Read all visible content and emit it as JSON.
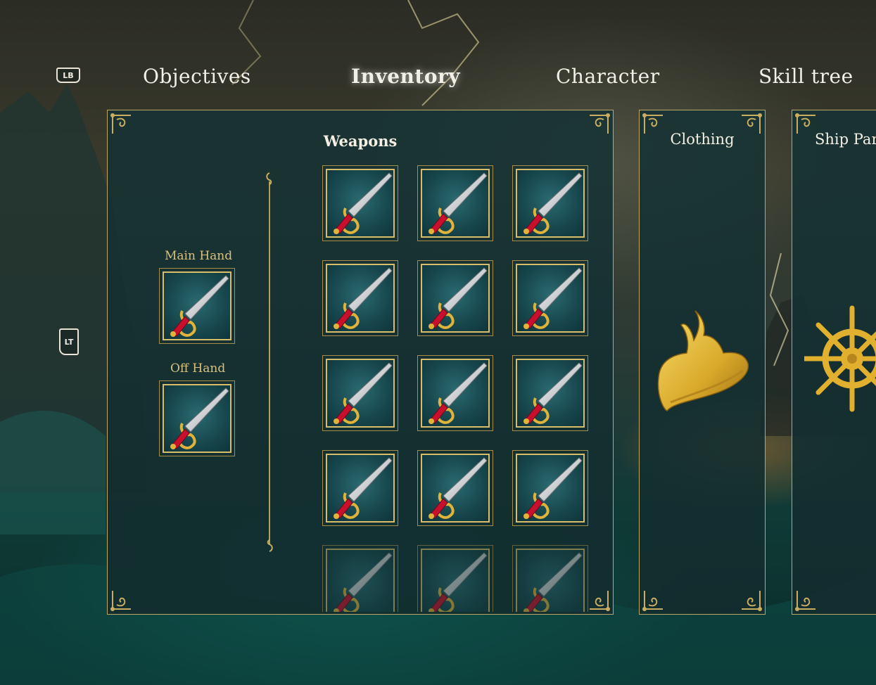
{
  "bumpers": {
    "left_bumper": "LB",
    "left_trigger": "LT"
  },
  "tabs": [
    {
      "label": "Objectives",
      "active": false
    },
    {
      "label": "Inventory",
      "active": true
    },
    {
      "label": "Character",
      "active": false
    },
    {
      "label": "Skill tree",
      "active": false
    }
  ],
  "weapons_panel": {
    "title": "Weapons",
    "equip_slots": [
      {
        "label": "Main Hand",
        "icon": "sword-icon"
      },
      {
        "label": "Off Hand",
        "icon": "sword-icon"
      }
    ],
    "grid_rows": 5,
    "grid_cols": 3,
    "item_icon": "sword-icon"
  },
  "clothing_panel": {
    "title": "Clothing",
    "icon": "pirate-hat-icon"
  },
  "ship_panel": {
    "title": "Ship Par",
    "icon": "ship-wheel-icon"
  },
  "colors": {
    "accent_gold": "#d8bd6a",
    "panel_bg": "#163234",
    "slot_bg": "#2a6a70",
    "sword_handle": "#c8102e"
  }
}
